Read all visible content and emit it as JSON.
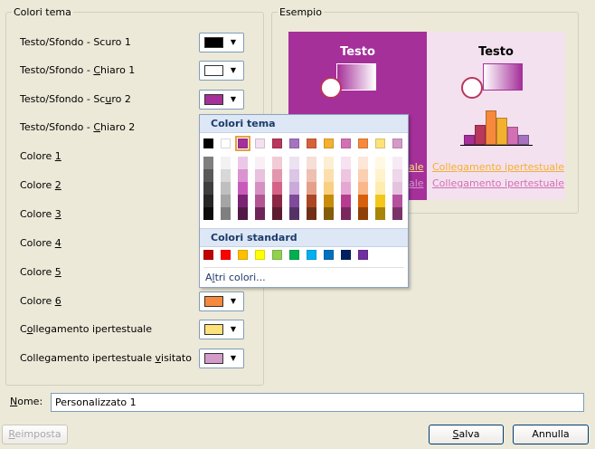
{
  "theme_group": {
    "legend": "Colori tema",
    "rows": [
      {
        "label_pre": "Testo/Sfondo - Scuro 1",
        "key": "",
        "label_post": "",
        "swatch": "#000000"
      },
      {
        "label_pre": "Testo/Sfondo - ",
        "key": "C",
        "label_post": "hiaro 1",
        "swatch": "#ffffff"
      },
      {
        "label_pre": "Testo/Sfondo - Sc",
        "key": "u",
        "label_post": "ro 2",
        "swatch": "#a5309a"
      },
      {
        "label_pre": "Testo/Sfondo - ",
        "key": "C",
        "label_post": "hiaro 2",
        "swatch": "#f4e1ef"
      },
      {
        "label_pre": "Colore ",
        "key": "1",
        "label_post": "",
        "swatch": "#b9365d"
      },
      {
        "label_pre": "Colore ",
        "key": "2",
        "label_post": "",
        "swatch": "#a773c0"
      },
      {
        "label_pre": "Colore ",
        "key": "3",
        "label_post": "",
        "swatch": "#d5623a"
      },
      {
        "label_pre": "Colore ",
        "key": "4",
        "label_post": "",
        "swatch": "#f4b02f"
      },
      {
        "label_pre": "Colore ",
        "key": "5",
        "label_post": "",
        "swatch": "#d370b4"
      },
      {
        "label_pre": "Colore ",
        "key": "6",
        "label_post": "",
        "swatch": "#f6893c"
      },
      {
        "label_pre": "C",
        "key": "o",
        "label_post": "llegamento ipertestuale",
        "swatch": "#fde27a"
      },
      {
        "label_pre": "Collegamento ipertestuale ",
        "key": "v",
        "label_post": "isitato",
        "swatch": "#d49ac9"
      }
    ]
  },
  "example_group": {
    "legend": "Esempio",
    "dark_panel": {
      "title": "Testo",
      "link1": "ale",
      "link2": "ale",
      "bg": "#a5309a"
    },
    "light_panel": {
      "title": "Testo",
      "link1": "Collegamento ipertestuale",
      "link2": "Collegamento ipertestuale",
      "bg": "#f4e1ef"
    },
    "histogram": [
      {
        "h": 0.28,
        "color": "#a5309a"
      },
      {
        "h": 0.55,
        "color": "#b9365d"
      },
      {
        "h": 0.95,
        "color": "#f6893c"
      },
      {
        "h": 0.75,
        "color": "#f4b02f"
      },
      {
        "h": 0.5,
        "color": "#d370b4"
      },
      {
        "h": 0.28,
        "color": "#a773c0"
      }
    ]
  },
  "popup": {
    "theme_header": "Colori tema",
    "theme_colors": [
      "#000000",
      "#ffffff",
      "#a5309a",
      "#f4e1ef",
      "#b9365d",
      "#a773c0",
      "#d5623a",
      "#f4b02f",
      "#d370b4",
      "#f6893c",
      "#fde27a",
      "#d49ac9"
    ],
    "shade_columns": [
      [
        "#7f7f7f",
        "#595959",
        "#3f3f3f",
        "#262626",
        "#0c0c0c"
      ],
      [
        "#f2f2f2",
        "#d8d8d8",
        "#bfbfbf",
        "#a5a5a5",
        "#7f7f7f"
      ],
      [
        "#ecc8e8",
        "#da92d1",
        "#c85bba",
        "#7b2473",
        "#521848"
      ],
      [
        "#f9f0f6",
        "#e9c2dd",
        "#d691c3",
        "#b25693",
        "#6e2459"
      ],
      [
        "#f1cbd7",
        "#e397af",
        "#d56387",
        "#8a2845",
        "#5c1b2e"
      ],
      [
        "#ede2f2",
        "#dbc6e5",
        "#c9aad9",
        "#7f4b9a",
        "#553266"
      ],
      [
        "#f6dfd7",
        "#eec0b0",
        "#e6a089",
        "#ab4724",
        "#722f18"
      ],
      [
        "#fdefd5",
        "#fbdfac",
        "#f9cf82",
        "#c88b0c",
        "#855c08"
      ],
      [
        "#f6e2f0",
        "#edc5e1",
        "#e4a8d2",
        "#b73b8e",
        "#7a275f"
      ],
      [
        "#fde7d8",
        "#fbcfb1",
        "#f9b78a",
        "#d6600b",
        "#8f4007"
      ],
      [
        "#fff9e4",
        "#fef3ca",
        "#feedaf",
        "#f3c61b",
        "#a88508"
      ],
      [
        "#f6ebf4",
        "#edd7e9",
        "#e4c3df",
        "#b5529e",
        "#7a3369"
      ]
    ],
    "standard_header": "Colori standard",
    "standard_colors": [
      "#c00000",
      "#ff0000",
      "#ffc000",
      "#ffff00",
      "#92d050",
      "#00b050",
      "#00b0f0",
      "#0070c0",
      "#002060",
      "#7030a0"
    ],
    "more_colors": {
      "pre": "A",
      "key": "l",
      "post": "tri colori..."
    }
  },
  "name_field": {
    "label_key": "N",
    "label_post": "ome:",
    "value": "Personalizzato 1"
  },
  "buttons": {
    "reset": {
      "key": "R",
      "post": "eimposta"
    },
    "save": {
      "key": "S",
      "post": "alva"
    },
    "cancel": "Annulla"
  }
}
